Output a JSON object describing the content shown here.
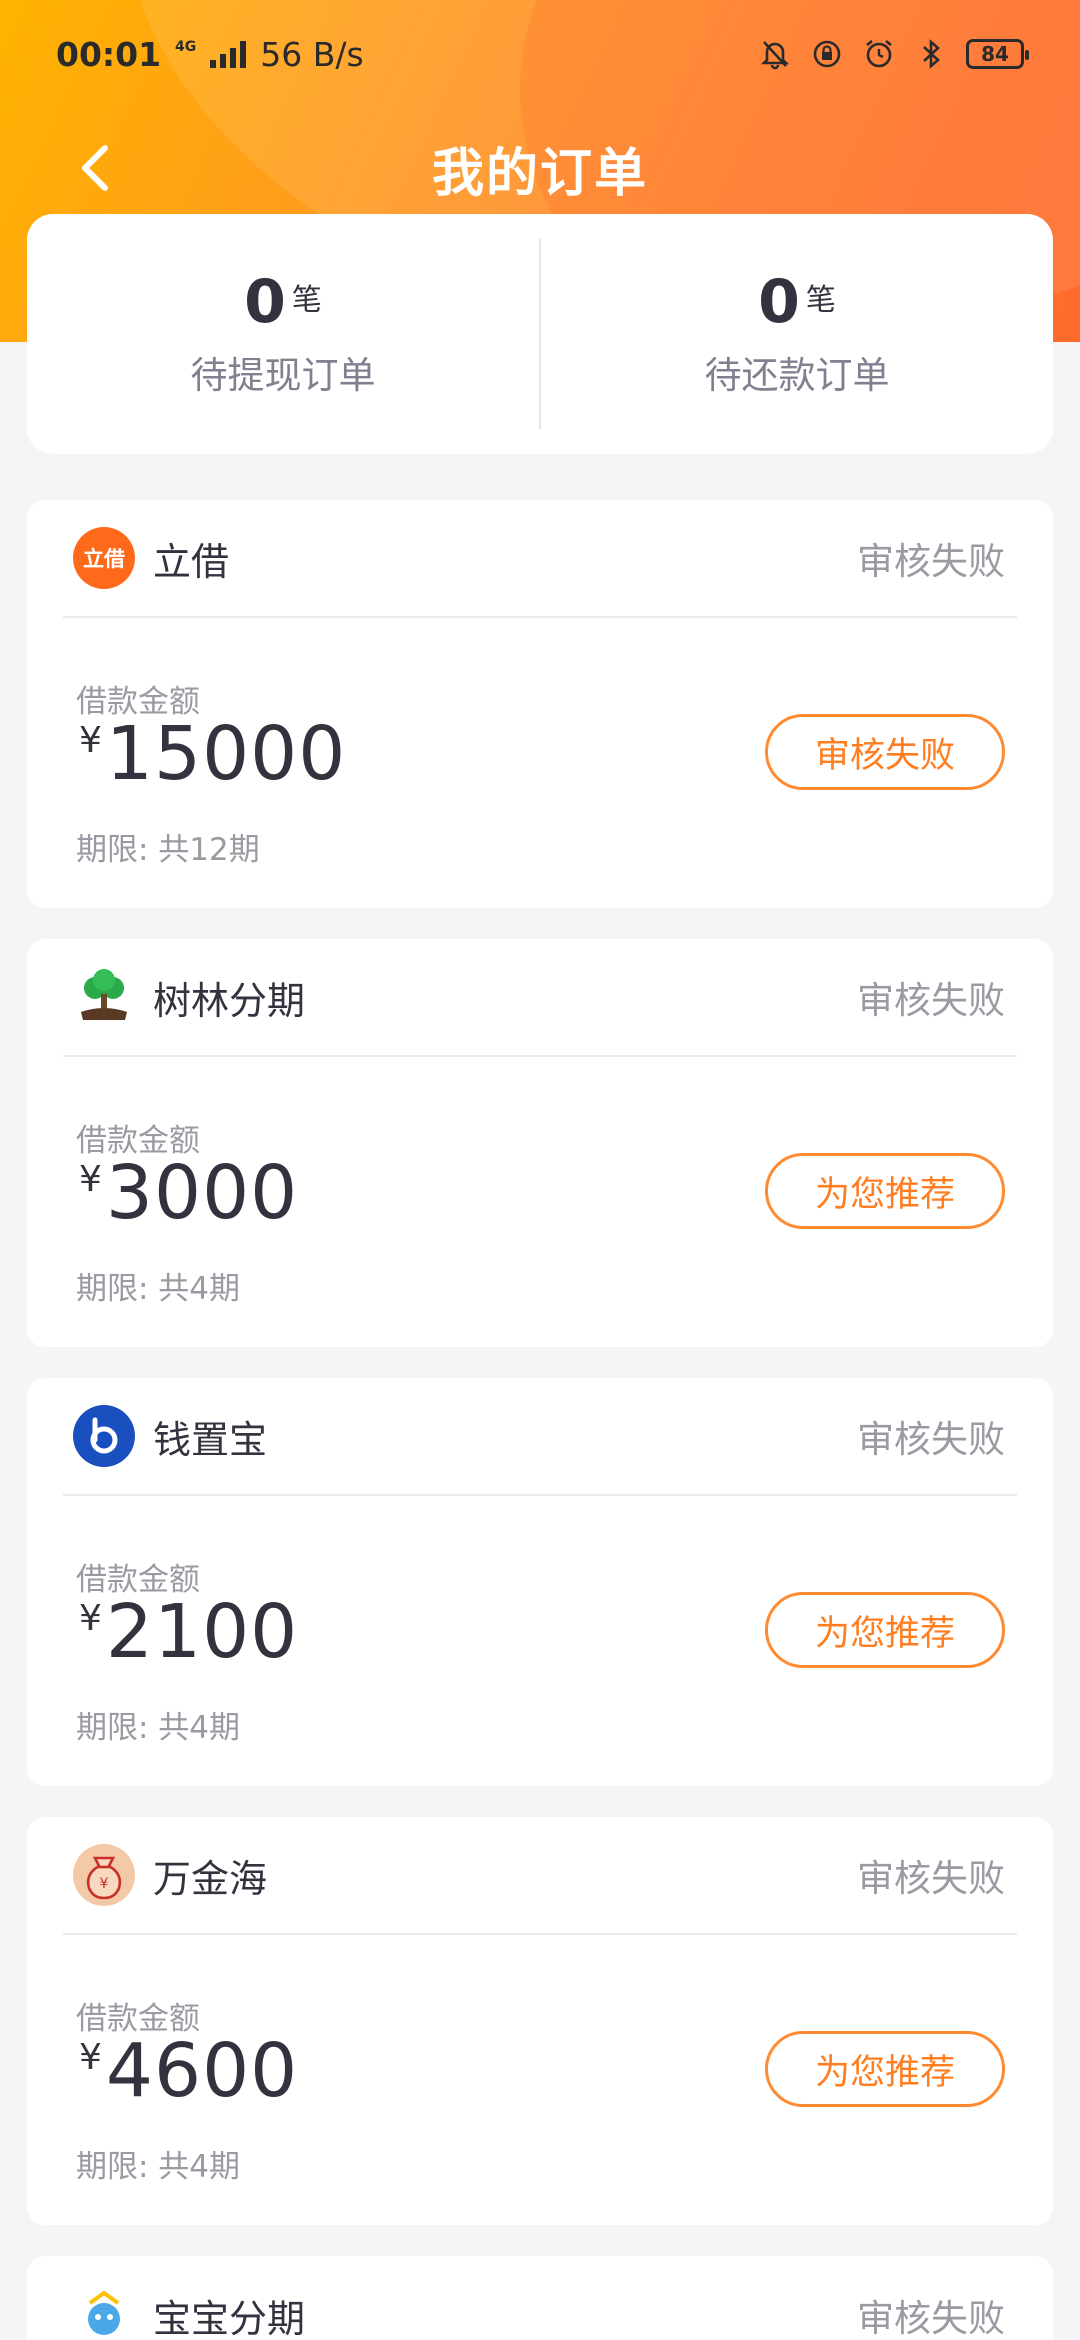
{
  "status_bar": {
    "time": "00:01",
    "network": "4G",
    "speed": "56 B/s",
    "battery": "84",
    "icons": [
      "mute-bell-icon",
      "rotation-lock-icon",
      "alarm-icon",
      "bluetooth-icon"
    ]
  },
  "nav": {
    "back_icon": "chevron-left-icon",
    "title": "我的订单"
  },
  "summary": {
    "pending_withdraw": {
      "count": "0",
      "unit": "笔",
      "label": "待提现订单"
    },
    "pending_repay": {
      "count": "0",
      "unit": "笔",
      "label": "待还款订单"
    }
  },
  "orders": [
    {
      "name": "立借",
      "head_status": "审核失败",
      "amount_label": "借款金额",
      "currency": "¥",
      "amount": "15000",
      "term": "期限: 共12期",
      "action": "审核失败",
      "logo_color": "#ff6a1a",
      "logo_text": "立借"
    },
    {
      "name": "树林分期",
      "head_status": "审核失败",
      "amount_label": "借款金额",
      "currency": "¥",
      "amount": "3000",
      "term": "期限: 共4期",
      "action": "为您推荐",
      "logo_color": "#2aa84a"
    },
    {
      "name": "钱置宝",
      "head_status": "审核失败",
      "amount_label": "借款金额",
      "currency": "¥",
      "amount": "2100",
      "term": "期限: 共4期",
      "action": "为您推荐",
      "logo_color": "#1a4fc0"
    },
    {
      "name": "万金海",
      "head_status": "审核失败",
      "amount_label": "借款金额",
      "currency": "¥",
      "amount": "4600",
      "term": "期限: 共4期",
      "action": "为您推荐",
      "logo_color": "#f4c9a8"
    },
    {
      "name": "宝宝分期",
      "head_status": "审核失败",
      "logo_color": "#4aa8e8"
    }
  ],
  "colors": {
    "accent": "#ff7e22",
    "header_gradient_start": "#ffb300",
    "header_gradient_end": "#ff6f2e",
    "page_bg": "#f5f5f7"
  }
}
